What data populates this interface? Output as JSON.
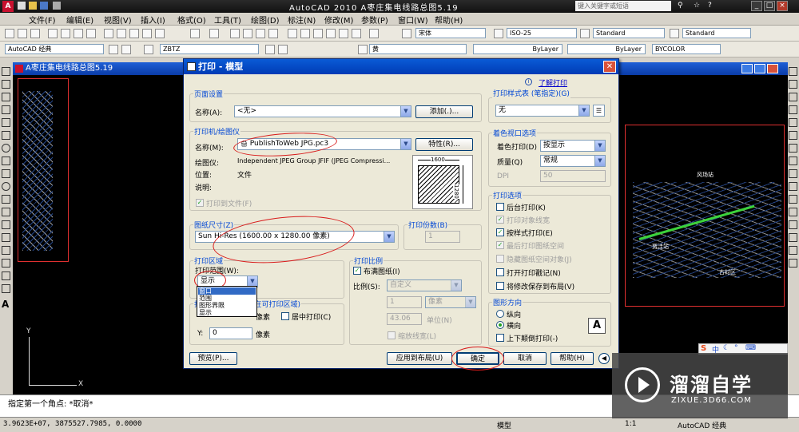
{
  "app": {
    "title": "AutoCAD 2010  A枣庄集电线路总图5.19",
    "search_placeholder": "键入关键字或短语"
  },
  "menu": [
    "文件(F)",
    "编辑(E)",
    "视图(V)",
    "插入(I)",
    "格式(O)",
    "工具(T)",
    "绘图(D)",
    "标注(N)",
    "修改(M)",
    "参数(P)",
    "窗口(W)",
    "帮助(H)"
  ],
  "toolbar": {
    "workspace": "AutoCAD 经典",
    "layer": "ZBTZ",
    "color": "黄",
    "linetype1": "ByLayer",
    "linetype2": "ByLayer",
    "plotstyle": "BYCOLOR",
    "font": "宋体",
    "dimstyle": "ISO-25",
    "tablestyle": "Standard",
    "mleaderstyle": "Standard"
  },
  "drawing": {
    "title": "A枣庄集电线路总图5.19",
    "labels": [
      "风场站",
      "贾洼站",
      "冬湖镇",
      "古村区"
    ]
  },
  "dialog": {
    "title": "打印 - 模型",
    "help_link": "了解打印",
    "page_setup": {
      "group": "页面设置",
      "name_label": "名称(A):",
      "name_value": "<无>",
      "add_button": "添加(.)..."
    },
    "printer": {
      "group": "打印机/绘图仪",
      "name_label": "名称(M):",
      "name_value": "PublishToWeb JPG.pc3",
      "properties_button": "特性(R)...",
      "plotter_label": "绘图仪:",
      "plotter_value": "Independent JPEG Group JFIF (JPEG Compressi...",
      "where_label": "位置:",
      "where_value": "文件",
      "desc_label": "说明:",
      "plot_to_file": "打印到文件(F)",
      "preview_width": "1600",
      "preview_height": "1280"
    },
    "paper": {
      "group": "图纸尺寸(Z)",
      "value": "Sun Hi-Res (1600.00 x 1280.00 像素)"
    },
    "copies": {
      "group": "打印份数(B)",
      "value": "1"
    },
    "area": {
      "group": "打印区域",
      "range_label": "打印范围(W):",
      "range_value": "显示",
      "options": [
        "窗口",
        "范围",
        "图形界限",
        "显示"
      ]
    },
    "offset": {
      "group": "打印偏移(原点设置在可打印区域)",
      "x_unit": "像素",
      "center_label": "居中打印(C)",
      "y_label": "Y:",
      "y_value": "0",
      "y_unit": "像素"
    },
    "scale": {
      "group": "打印比例",
      "fit_label": "布满图纸(I)",
      "ratio_label": "比例(S):",
      "ratio_value": "自定义",
      "val1": "1",
      "unit1": "像素",
      "val2": "43.06",
      "unit2": "单位(N)",
      "lineweights": "缩放线宽(L)"
    },
    "plotstyle": {
      "group": "打印样式表 (笔指定)(G)",
      "value": "无"
    },
    "shaded": {
      "group": "着色视口选项",
      "shade_label": "着色打印(D)",
      "shade_value": "按显示",
      "quality_label": "质量(Q)",
      "quality_value": "常规",
      "dpi_label": "DPI",
      "dpi_value": "50"
    },
    "options": {
      "group": "打印选项",
      "items": [
        "后台打印(K)",
        "打印对象线宽",
        "按样式打印(E)",
        "最后打印图纸空间",
        "隐藏图纸空间对象(J)",
        "打开打印戳记(N)",
        "将修改保存到布局(V)"
      ]
    },
    "orientation": {
      "group": "图形方向",
      "portrait": "纵向",
      "landscape": "横向",
      "upside": "上下颠倒打印(-)"
    },
    "buttons": {
      "preview": "预览(P)...",
      "apply": "应用到布局(U)",
      "ok": "确定",
      "cancel": "取消",
      "help": "帮助(H)"
    }
  },
  "command": {
    "line": "指定第一个角点: *取消*"
  },
  "status": {
    "coords": "3.9623E+07, 3875527.7985, 0.0000",
    "model": "模型",
    "scale": "1:1",
    "workspace": "AutoCAD 经典"
  },
  "watermark": {
    "brand": "溜溜自学",
    "url": "ZIXUE.3D66.COM"
  }
}
